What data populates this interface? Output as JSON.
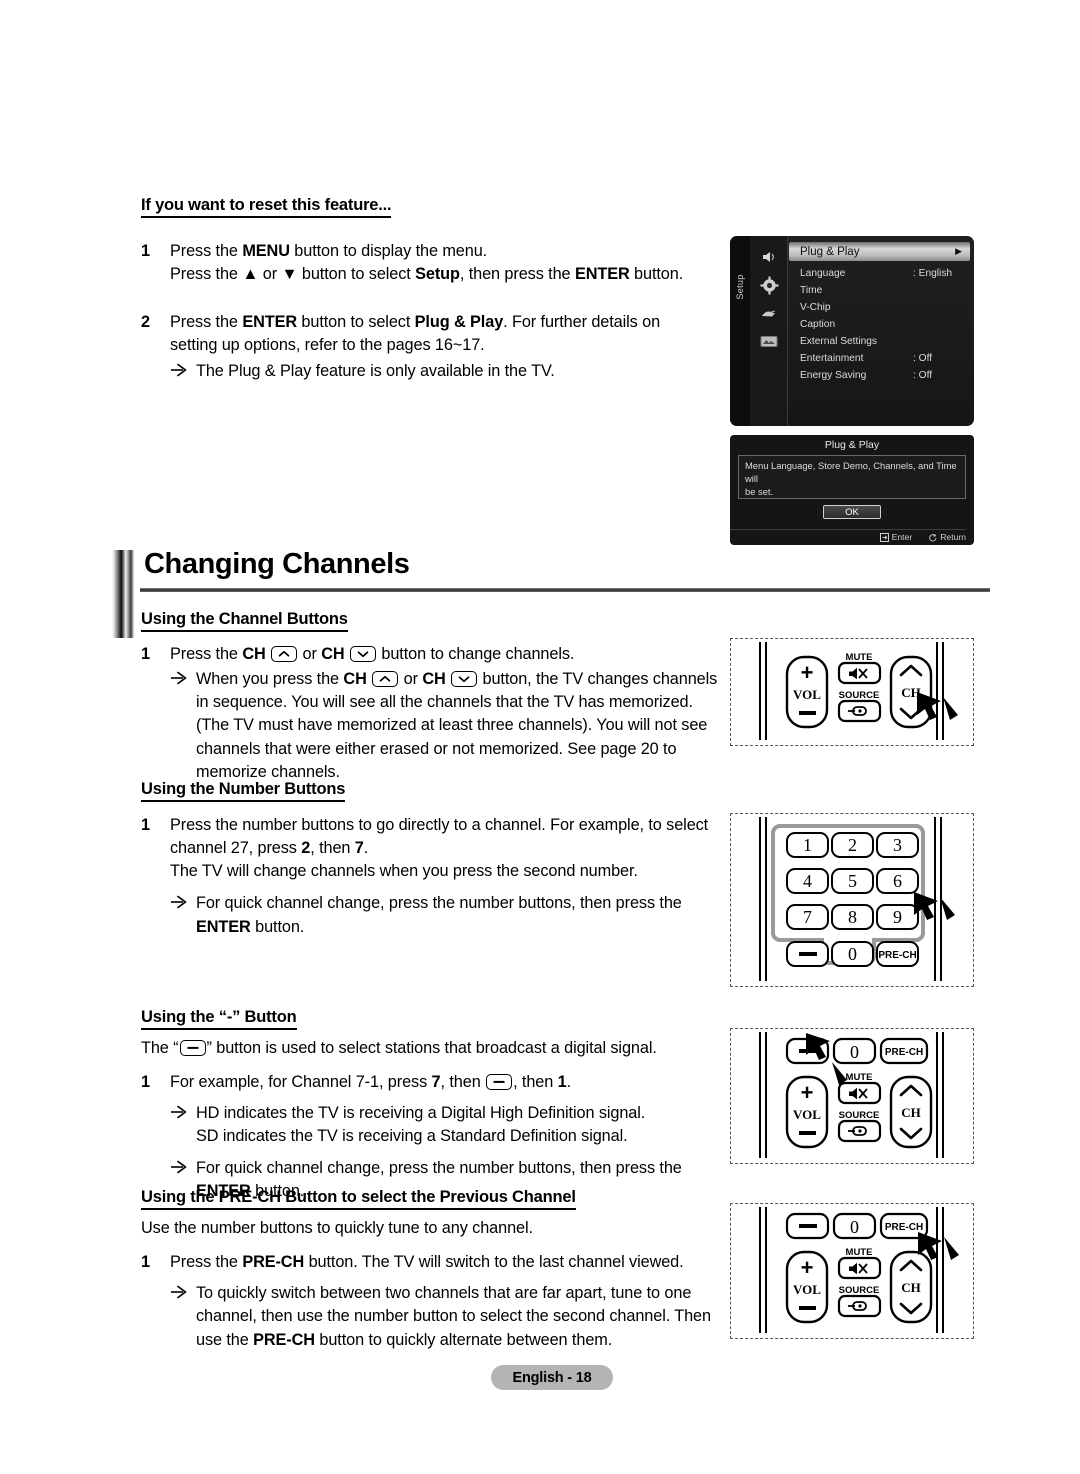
{
  "document": {
    "page_title": "Changing Channels",
    "footer": "English - 18"
  },
  "reset_section": {
    "heading": "If you want to reset this feature...",
    "step1": {
      "num": "1",
      "line1_a": "Press the ",
      "line1_b": "MENU",
      "line1_c": " button to display the menu.",
      "line2_a": "Press the ",
      "line2_up": "▲",
      "line2_b": " or ",
      "line2_down": "▼",
      "line2_c": " button to select ",
      "line2_d": "Setup",
      "line2_e": ", then press the ",
      "line2_f": "ENTER",
      "line2_g": " button."
    },
    "step2": {
      "num": "2",
      "a": "Press the ",
      "b": "ENTER",
      "c": " button to select ",
      "d": "Plug & Play",
      "e": ". For further details on setting up options, refer to the pages 16~17.",
      "bullet": "The Plug & Play feature is only available in the TV."
    }
  },
  "osd_menu": {
    "tab_label": "Setup",
    "icons": [
      "sound-icon",
      "setup-gear-icon",
      "input-icon",
      "picture-icon"
    ],
    "rows": [
      {
        "label": "Plug & Play",
        "value": "",
        "selected": true,
        "carat": "▶"
      },
      {
        "label": "Language",
        "value": ": English",
        "selected": false,
        "carat": ""
      },
      {
        "label": "Time",
        "value": "",
        "selected": false,
        "carat": ""
      },
      {
        "label": "V-Chip",
        "value": "",
        "selected": false,
        "carat": ""
      },
      {
        "label": "Caption",
        "value": "",
        "selected": false,
        "carat": ""
      },
      {
        "label": "External Settings",
        "value": "",
        "selected": false,
        "carat": ""
      },
      {
        "label": "Entertainment",
        "value": ": Off",
        "selected": false,
        "carat": ""
      },
      {
        "label": "Energy Saving",
        "value": ": Off",
        "selected": false,
        "carat": ""
      }
    ]
  },
  "osd_dialog": {
    "title": "Plug & Play",
    "message_line1": "Menu Language, Store Demo, Channels, and Time",
    "message_line2": "will",
    "message_line3": "be set.",
    "ok_label": "OK",
    "enter_label": "Enter",
    "return_label": "Return"
  },
  "channel_buttons": {
    "heading": "Using the Channel Buttons",
    "step1": {
      "num": "1",
      "a": "Press the ",
      "ch1": "CH",
      "icon1": "chevron-up-key-icon",
      "b": " or ",
      "ch2": "CH",
      "icon2": "chevron-down-key-icon",
      "c": " button to change channels."
    },
    "bullet": {
      "a": "When you press the ",
      "ch1": "CH",
      "icon1": "chevron-up-key-icon",
      "b": " or ",
      "ch2": "CH",
      "icon2": "chevron-down-key-icon",
      "c": " button, the TV changes channels in sequence. You will see all the channels that the TV has memorized. (The TV must have memorized at least three channels). You will not see channels that were either erased or not memorized. See page 20 to memorize channels."
    }
  },
  "number_buttons": {
    "heading": "Using the Number Buttons",
    "step1": {
      "num": "1",
      "a": "Press the number buttons to go directly to a channel. For example, to select channel 27, press ",
      "b": "2",
      "c": ", then ",
      "d": "7",
      "e": ".",
      "line2": "The TV will change channels when you press the second number."
    },
    "bullet": {
      "a": "For quick channel change, press the number buttons, then press the ",
      "b": "ENTER",
      "c": " button."
    }
  },
  "dash_button": {
    "heading_a": "Using the “",
    "heading_b": "-",
    "heading_c": "” Button",
    "intro_a": "The “",
    "intro_icon": "dash-key-icon",
    "intro_b": "” button is used to select stations that broadcast a digital signal.",
    "step1": {
      "num": "1",
      "a": "For example, for Channel 7-1, press ",
      "b": "7",
      "c": ", then ",
      "icon": "dash-key-icon",
      "d": ", then ",
      "e": "1",
      "f": "."
    },
    "bullet1_line1": "HD indicates the TV is receiving a Digital High Definition signal.",
    "bullet1_line2": "SD indicates the TV is receiving a Standard Definition signal.",
    "bullet2": {
      "a": "For quick channel change, press the number buttons, then press the ",
      "b": "ENTER",
      "c": " button."
    }
  },
  "prech_section": {
    "heading": "Using the PRE-CH Button to select the Previous Channel",
    "intro": "Use the number buttons to quickly tune to any channel.",
    "step1": {
      "num": "1",
      "a": "Press the ",
      "b": "PRE-CH",
      "c": " button. The TV will switch to the last channel viewed."
    },
    "bullet": {
      "a": "To quickly switch between two channels that are far apart, tune to one channel, then use the number button to select the second channel. Then use the ",
      "b": "PRE-CH",
      "c": " button to quickly alternate between them."
    }
  },
  "remotes": {
    "labels": {
      "vol": "VOL",
      "mute": "MUTE",
      "source": "SOURCE",
      "ch": "CH",
      "plus": "+",
      "minus": "−",
      "prech": "PRE-CH",
      "zero": "0",
      "dash": "−"
    },
    "keypad": [
      "1",
      "2",
      "3",
      "4",
      "5",
      "6",
      "7",
      "8",
      "9"
    ],
    "keypad_bottom": [
      "−",
      "0",
      "PRE-CH"
    ]
  },
  "colors": {
    "page_bg": "#ffffff",
    "text": "#000000",
    "osd_bg": "#1a1a1a",
    "osd_selected": "#d8d8d8",
    "footer_badge": "#b4b4b4"
  }
}
